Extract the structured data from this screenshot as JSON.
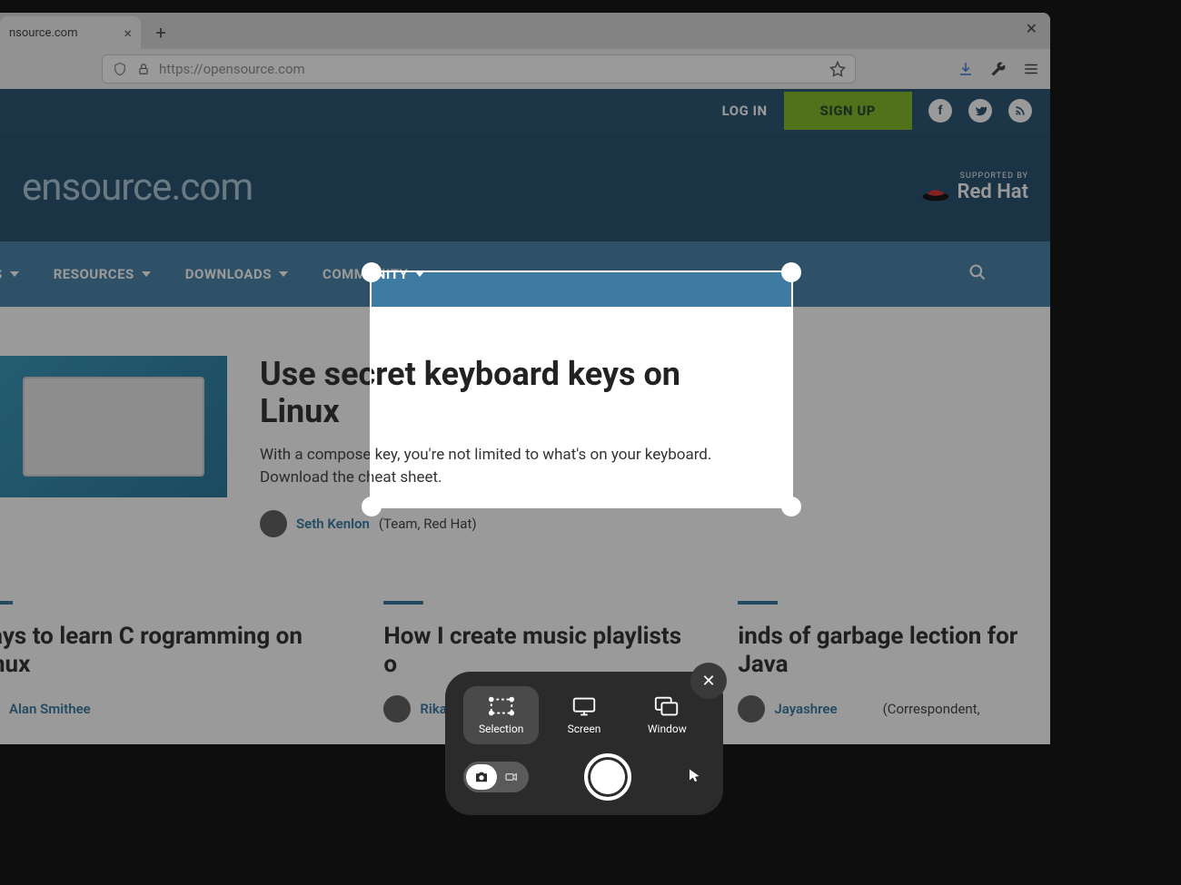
{
  "browser": {
    "tab_title": "nsource.com",
    "url_display": "https://opensource.com",
    "url_host": "opensource.com"
  },
  "topnav": {
    "login": "LOG IN",
    "signup": "SIGN UP"
  },
  "banner": {
    "logo": "ensource.com",
    "supported": "SUPPORTED BY",
    "sponsor": "Red Hat"
  },
  "mainnav": {
    "items": [
      "ES",
      "RESOURCES",
      "DOWNLOADS",
      "COMMUNITY"
    ]
  },
  "article": {
    "title": "Use secret keyboard keys on Linux",
    "summary": "With a compose key, you're not limited to what's on your keyboard. Download the cheat sheet.",
    "author": "Seth Kenlon",
    "author_meta": "(Team, Red Hat)"
  },
  "cards": [
    {
      "title": "ways to learn C rogramming on Linux",
      "author": "Alan Smithee",
      "meta": ""
    },
    {
      "title": "How I create music playlists o",
      "author": "Rikard Gro",
      "meta": ""
    },
    {
      "title": "inds of garbage lection for Java",
      "author": "Jayashree",
      "meta": "(Correspondent,"
    }
  ],
  "screenshot_tool": {
    "modes": [
      "Selection",
      "Screen",
      "Window"
    ],
    "active_mode": 0
  }
}
